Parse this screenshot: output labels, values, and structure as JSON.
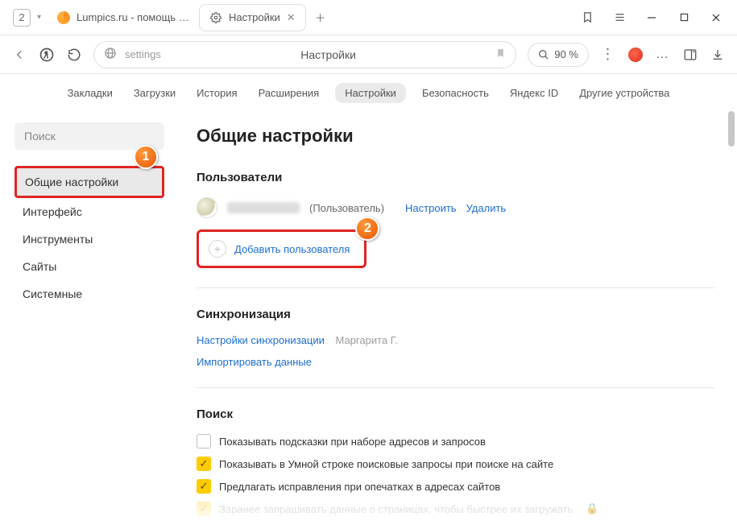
{
  "titlebar": {
    "tab_count": "2",
    "tab1_label": "Lumpics.ru - помощь с ком",
    "tab2_label": "Настройки"
  },
  "toolbar": {
    "addr_text": "settings",
    "addr_title": "Настройки",
    "zoom_label": "90 %"
  },
  "nav": {
    "items": [
      "Закладки",
      "Загрузки",
      "История",
      "Расширения",
      "Настройки",
      "Безопасность",
      "Яндекс ID",
      "Другие устройства"
    ],
    "active_index": 4
  },
  "sidebar": {
    "search_placeholder": "Поиск",
    "items": [
      "Общие настройки",
      "Интерфейс",
      "Инструменты",
      "Сайты",
      "Системные"
    ],
    "active_index": 0
  },
  "content": {
    "title": "Общие настройки",
    "users_heading": "Пользователи",
    "user_role": "(Пользователь)",
    "user_settings_link": "Настроить",
    "user_delete_link": "Удалить",
    "add_user_label": "Добавить пользователя",
    "sync_heading": "Синхронизация",
    "sync_settings_link": "Настройки синхронизации",
    "sync_user_name": "Маргарита Г.",
    "import_link": "Импортировать данные",
    "search_heading": "Поиск",
    "check1": "Показывать подсказки при наборе адресов и запросов",
    "check2": "Показывать в Умной строке поисковые запросы при поиске на сайте",
    "check3": "Предлагать исправления при опечатках в адресах сайтов",
    "partial": "Заранее запрашивать данные о страницах, чтобы быстрее их загружать"
  },
  "callouts": {
    "one": "1",
    "two": "2"
  }
}
